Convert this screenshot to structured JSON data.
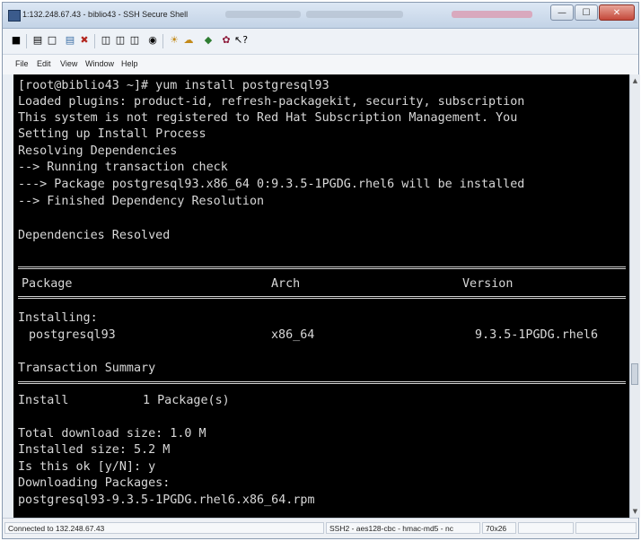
{
  "window": {
    "title": "1:132.248.67.43 - biblio43 - SSH Secure Shell"
  },
  "menu": {
    "file": "File",
    "edit": "Edit",
    "view": "View",
    "window": "Window",
    "help": "Help"
  },
  "toolbar_icons": [
    "save-icon",
    "print-icon",
    "print-preview-icon",
    "quick-connect-icon",
    "profiles-icon",
    "copy-icon",
    "paste-icon",
    "find-icon",
    "settings-icon",
    "sftp-icon",
    "new-terminal-icon",
    "help-icon"
  ],
  "terminal": {
    "l1": "[root@biblio43 ~]# yum install postgresql93",
    "l2": "Loaded plugins: product-id, refresh-packagekit, security, subscription",
    "l3": "This system is not registered to Red Hat Subscription Management. You",
    "l4": "Setting up Install Process",
    "l5": "Resolving Dependencies",
    "l6": "--> Running transaction check",
    "l7": "---> Package postgresql93.x86_64 0:9.3.5-1PGDG.rhel6 will be installed",
    "l8": "--> Finished Dependency Resolution",
    "l9": "Dependencies Resolved",
    "table": {
      "col_package": "Package",
      "col_arch": "Arch",
      "col_version": "Version",
      "installing": "Installing:",
      "pkg_name": "postgresql93",
      "pkg_arch": "x86_64",
      "pkg_version": "9.3.5-1PGDG.rhel6"
    },
    "summary_title": "Transaction Summary",
    "install_label": "Install",
    "install_count": "1 Package(s)",
    "l_total": "Total download size: 1.0 M",
    "l_installed": "Installed size: 5.2 M",
    "l_prompt": "Is this ok [y/N]: y",
    "l_downloading": "Downloading Packages:",
    "l_rpm": "postgresql93-9.3.5-1PGDG.rhel6.x86_64.rpm"
  },
  "status": {
    "connected": "Connected to 132.248.67.43",
    "cipher": "SSH2 - aes128-cbc - hmac-md5 - nc",
    "size": "70x26"
  }
}
